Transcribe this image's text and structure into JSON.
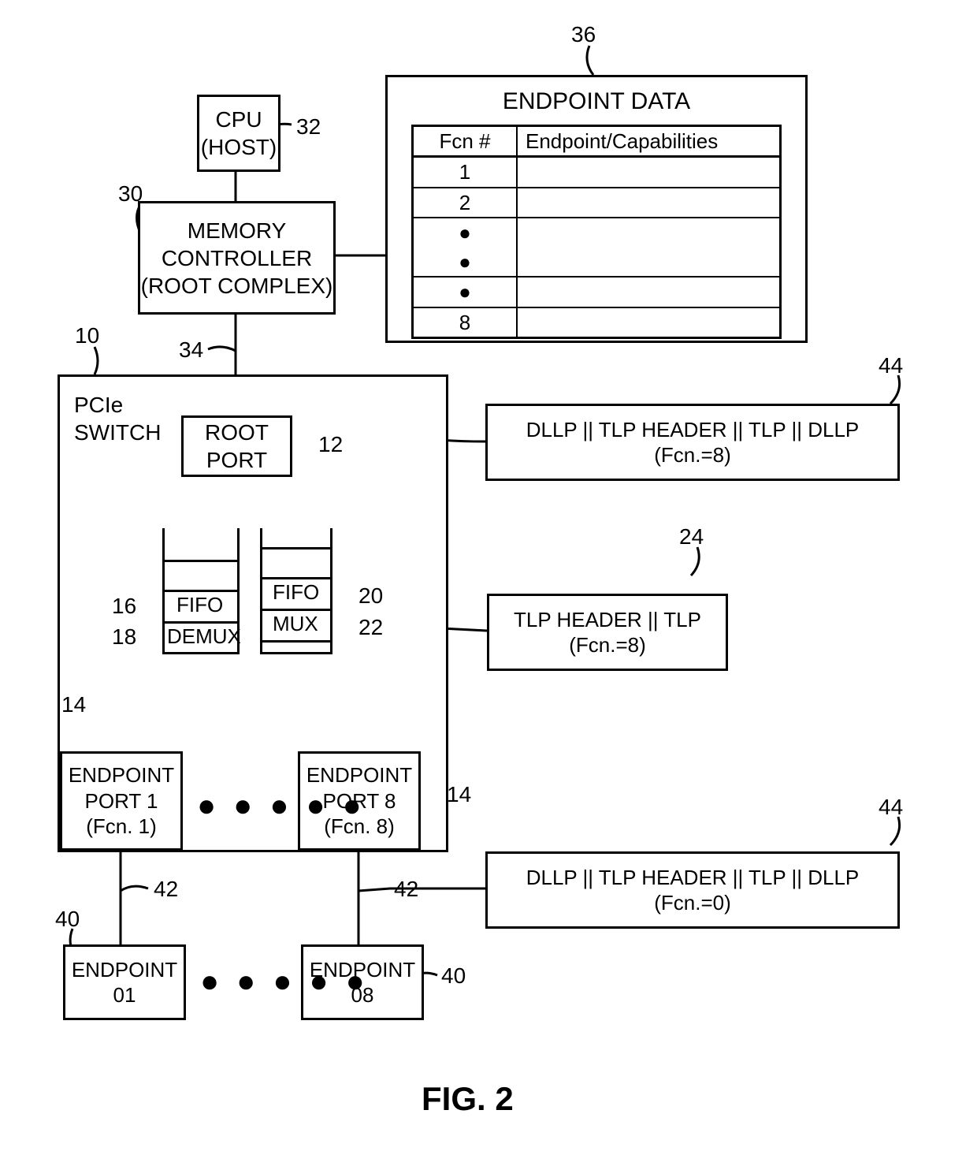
{
  "figure_label": "FIG. 2",
  "refs": {
    "cpu": "32",
    "memctl": "30",
    "link_root": "34",
    "endpoint_data": "36",
    "switch": "10",
    "root_port": "12",
    "ep_port_left": "14",
    "ep_port_right": "14",
    "fifo_left": "16",
    "demux": "18",
    "fifo_right": "20",
    "mux": "22",
    "tlp_callout": "24",
    "dllp_upper": "44",
    "dllp_lower": "44",
    "link_ep": "42",
    "link_ep2": "42",
    "endpoint01": "40",
    "endpoint08": "40"
  },
  "blocks": {
    "cpu_l1": "CPU",
    "cpu_l2": "(HOST)",
    "memctl_l1": "MEMORY",
    "memctl_l2": "CONTROLLER",
    "memctl_l3": "(ROOT COMPLEX)",
    "endpoint_data_title": "ENDPOINT DATA",
    "table_h1": "Fcn #",
    "table_h2": "Endpoint/Capabilities",
    "table_rows": [
      "1",
      "2",
      "8"
    ],
    "switch_l1": "PCIe",
    "switch_l2": "SWITCH",
    "root_port_l1": "ROOT",
    "root_port_l2": "PORT",
    "fifo_label": "FIFO",
    "demux_label": "DEMUX",
    "mux_label": "MUX",
    "ep_port_left_l1": "ENDPOINT",
    "ep_port_left_l2": "PORT 1",
    "ep_port_left_l3": "(Fcn. 1)",
    "ep_port_right_l1": "ENDPOINT",
    "ep_port_right_l2": "PORT 8",
    "ep_port_right_l3": "(Fcn. 8)",
    "endpoint01_l1": "ENDPOINT",
    "endpoint01_l2": "01",
    "endpoint08_l1": "ENDPOINT",
    "endpoint08_l2": "08",
    "dllp_upper_l1": "DLLP || TLP HEADER || TLP || DLLP",
    "dllp_upper_l2": "(Fcn.=8)",
    "tlp_l1": "TLP HEADER || TLP",
    "tlp_l2": "(Fcn.=8)",
    "dllp_lower_l1": "DLLP || TLP HEADER || TLP || DLLP",
    "dllp_lower_l2": "(Fcn.=0)"
  }
}
